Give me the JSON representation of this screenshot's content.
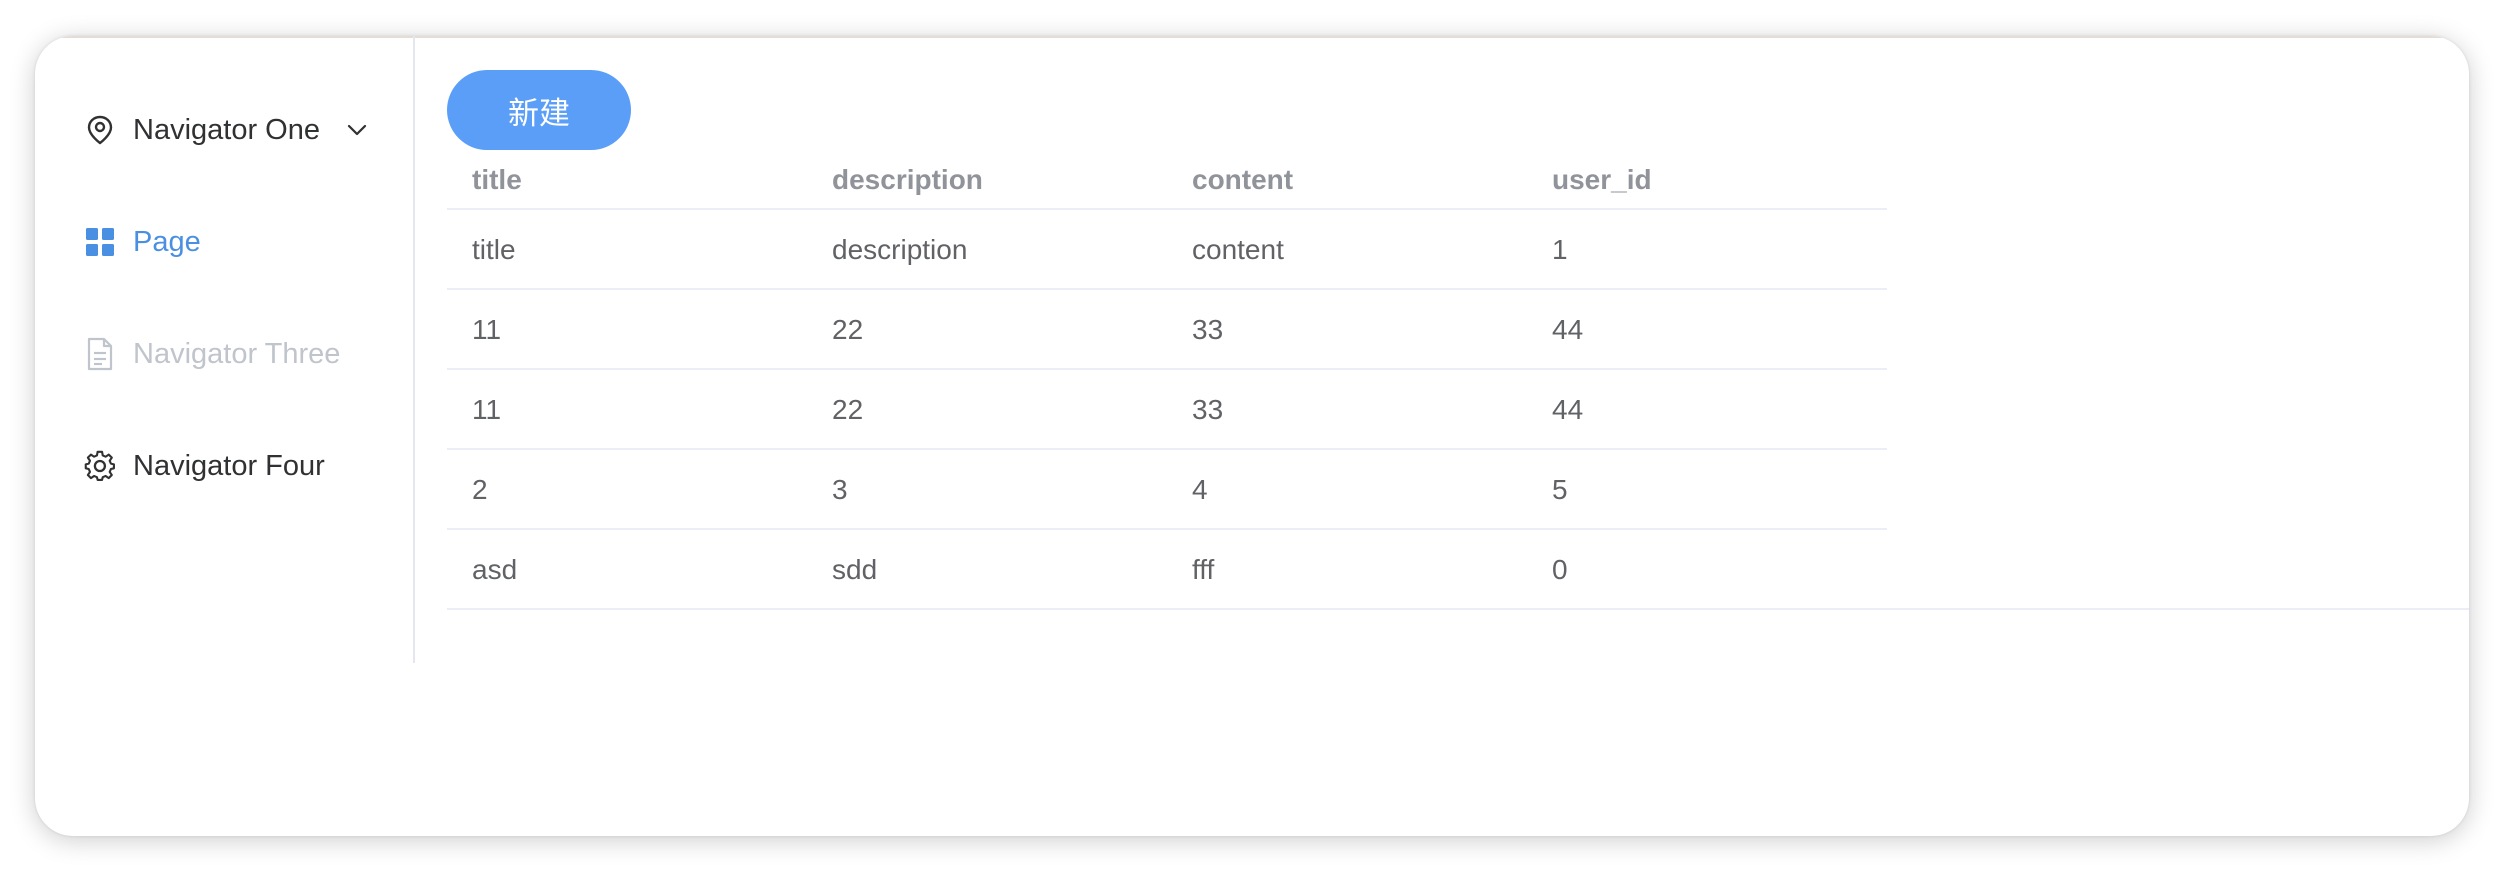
{
  "sidebar": {
    "items": [
      {
        "label": "Navigator One",
        "icon": "location-icon",
        "state": "submenu"
      },
      {
        "label": "Page",
        "icon": "grid-icon",
        "state": "active"
      },
      {
        "label": "Navigator Three",
        "icon": "document-icon",
        "state": "disabled"
      },
      {
        "label": "Navigator Four",
        "icon": "gear-icon",
        "state": "normal"
      }
    ]
  },
  "toolbar": {
    "new_label": "新建"
  },
  "table": {
    "columns": [
      "title",
      "description",
      "content",
      "user_id"
    ],
    "rows": [
      [
        "title",
        "description",
        "content",
        "1"
      ],
      [
        "11",
        "22",
        "33",
        "44"
      ],
      [
        "11",
        "22",
        "33",
        "44"
      ],
      [
        "2",
        "3",
        "4",
        "5"
      ],
      [
        "asd",
        "sdd",
        "fff",
        "0"
      ]
    ]
  },
  "colors": {
    "accent": "#4a90e2",
    "button": "#5b9ef7",
    "disabled": "#c0c4cc",
    "header_text": "#909399",
    "cell_text": "#606266"
  }
}
